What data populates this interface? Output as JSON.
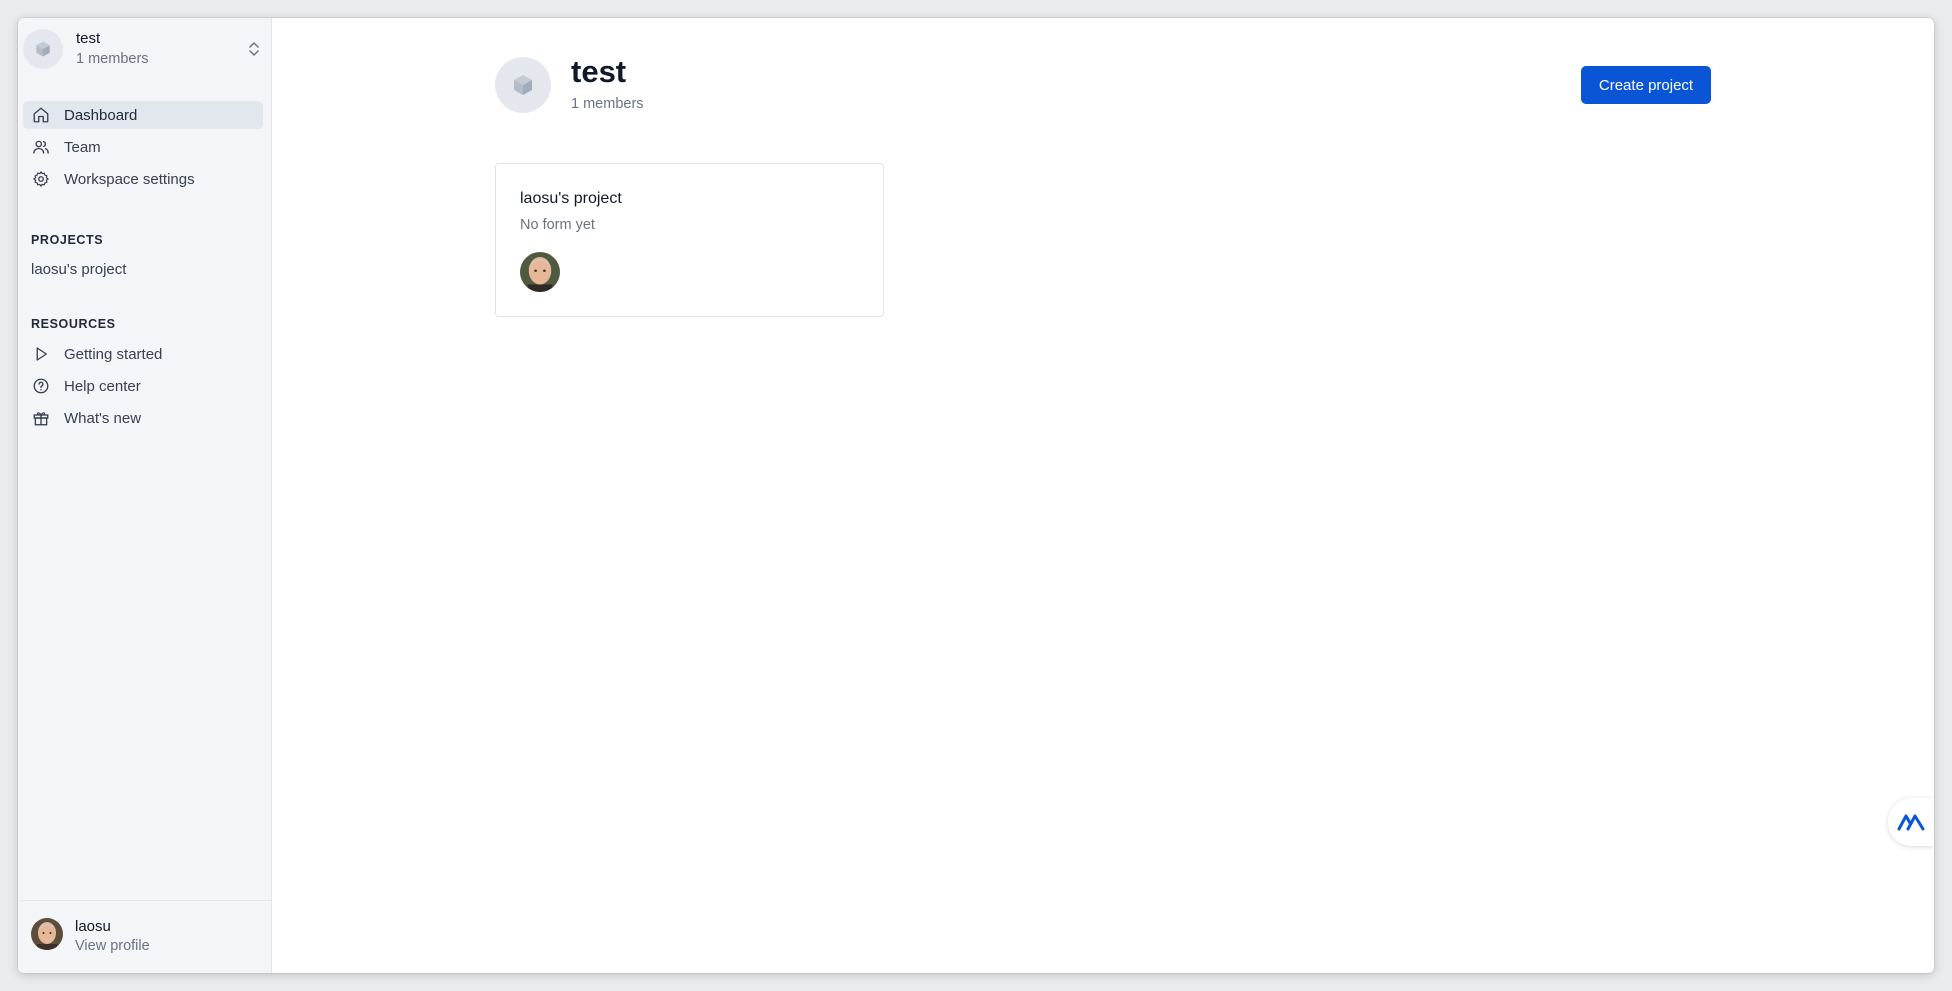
{
  "workspace": {
    "name": "test",
    "members": "1 members"
  },
  "nav": {
    "dashboard": "Dashboard",
    "team": "Team",
    "workspace_settings": "Workspace settings"
  },
  "projects_section": {
    "title": "PROJECTS",
    "items": [
      "laosu's project"
    ]
  },
  "resources_section": {
    "title": "RESOURCES",
    "items": [
      {
        "label": "Getting started",
        "icon": "play-icon"
      },
      {
        "label": "Help center",
        "icon": "help-circle-icon"
      },
      {
        "label": "What's new",
        "icon": "gift-icon"
      }
    ]
  },
  "profile": {
    "name": "laosu",
    "link": "View profile"
  },
  "main": {
    "title": "test",
    "members": "1 members",
    "create_button": "Create project",
    "cards": [
      {
        "title": "laosu's project",
        "subtitle": "No form yet"
      }
    ]
  },
  "colors": {
    "accent": "#0a54d6",
    "sidebar_bg": "#f3f5f8",
    "active_nav_bg": "#e2e7ee"
  }
}
